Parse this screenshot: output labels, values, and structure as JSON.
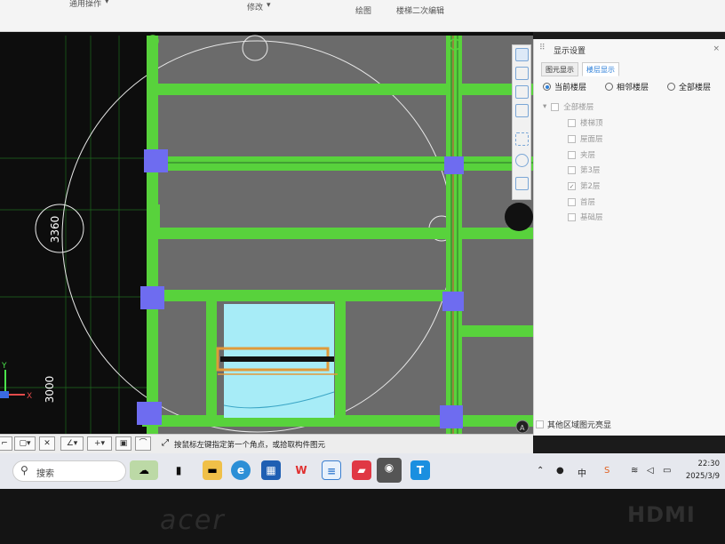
{
  "ribbon": {
    "common_ops": "通用操作",
    "modify": "修改",
    "draw": "绘图",
    "stair_edit": "楼梯二次编辑"
  },
  "cad": {
    "dim_top": "3360",
    "dim_bottom": "3000",
    "axis_y": "Y",
    "axis_x": "X",
    "corner_badge": "A"
  },
  "panel": {
    "title": "显示设置",
    "close": "×",
    "tabs": [
      "图元显示",
      "楼层显示"
    ],
    "radios": [
      "当前楼层",
      "相邻楼层",
      "全部楼层"
    ],
    "tree_root": "全部楼层",
    "floors": [
      {
        "label": "楼梯顶",
        "checked": false
      },
      {
        "label": "屋面层",
        "checked": false
      },
      {
        "label": "夹层",
        "checked": false
      },
      {
        "label": "第3层",
        "checked": false
      },
      {
        "label": "第2层",
        "checked": true
      },
      {
        "label": "首层",
        "checked": false
      },
      {
        "label": "基础层",
        "checked": false
      }
    ],
    "footer_checkbox": "其他区域图元亮显"
  },
  "status": {
    "hint": "按鼠标左键指定第一个角点，或拾取构件图元"
  },
  "taskbar": {
    "search_placeholder": "搜索",
    "time": "22:30",
    "date": "2025/3/9",
    "tray_ime": "中",
    "tray_cloud": "S"
  },
  "bezel": {
    "brand": "acer",
    "hdmi": "HDMI"
  },
  "colors": {
    "beam_green": "#58d23c",
    "column_blue": "#6e6cf0",
    "slab_cyan": "#a7ecf7",
    "selection_orange": "#e09a3a",
    "cad_gray": "#6b6b6b",
    "accent_blue": "#2d7fd8"
  }
}
